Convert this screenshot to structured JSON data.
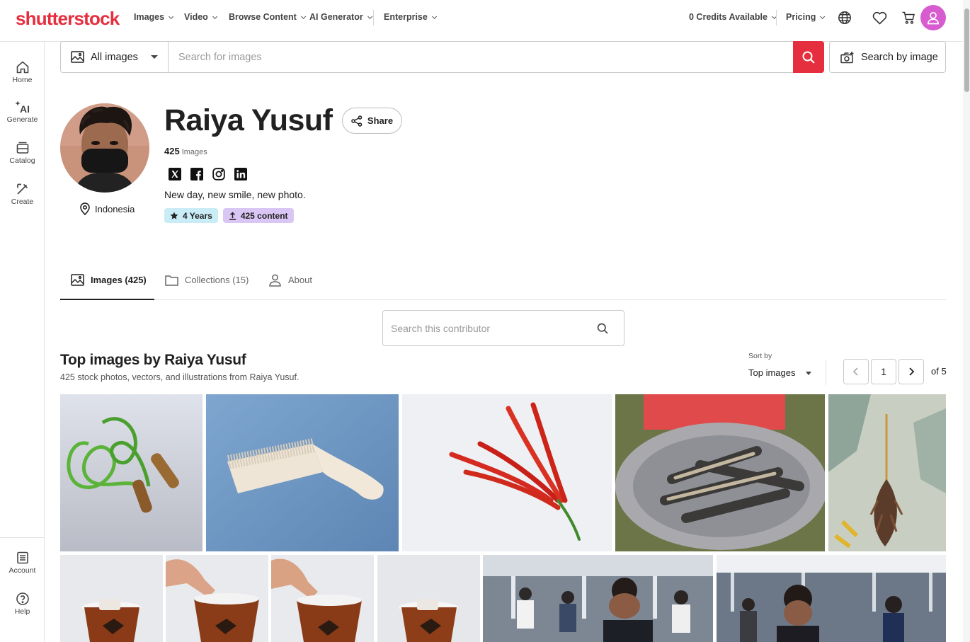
{
  "brand": {
    "logo_text": "shutterstock",
    "color": "#e62f3e"
  },
  "topnav": {
    "items": [
      {
        "label": "Images"
      },
      {
        "label": "Video"
      },
      {
        "label": "Browse Content"
      },
      {
        "label": "AI Generator"
      },
      {
        "label": "Enterprise"
      }
    ],
    "credits": "0 Credits Available",
    "pricing": "Pricing",
    "icons": [
      "globe-icon",
      "heart-icon",
      "cart-icon",
      "user-icon"
    ]
  },
  "rail": {
    "items": [
      {
        "label": "Home",
        "icon": "home-icon"
      },
      {
        "label": "Generate",
        "icon": "ai-sparkle-icon"
      },
      {
        "label": "Catalog",
        "icon": "catalog-icon"
      },
      {
        "label": "Create",
        "icon": "create-icon"
      }
    ],
    "bottom": [
      {
        "label": "Account",
        "icon": "account-icon"
      },
      {
        "label": "Help",
        "icon": "help-icon"
      }
    ]
  },
  "search": {
    "category": "All images",
    "placeholder": "Search for images",
    "by_image_label": "Search by image"
  },
  "profile": {
    "name": "Raiya Yusuf",
    "share_label": "Share",
    "image_count": "425",
    "image_count_label": "Images",
    "socials": [
      "x-icon",
      "facebook-icon",
      "instagram-icon",
      "linkedin-icon"
    ],
    "bio": "New day, new smile, new photo.",
    "location": "Indonesia",
    "badges": [
      {
        "label": "4 Years",
        "color": "#c9ecf7"
      },
      {
        "label": "425 content",
        "color": "#d9c6f5"
      }
    ]
  },
  "tabs": [
    {
      "label": "Images (425)",
      "active": true
    },
    {
      "label": "Collections (15)",
      "active": false
    },
    {
      "label": "About",
      "active": false
    }
  ],
  "contributor_search": {
    "placeholder": "Search this contributor"
  },
  "section": {
    "title": "Top images by Raiya Yusuf",
    "subtitle": "425 stock photos, vectors, and illustrations from Raiya Yusuf.",
    "sort_label": "Sort by",
    "sort_value": "Top images"
  },
  "pagination": {
    "current": "1",
    "total_label": "of 5"
  },
  "images_row1": [
    {
      "subject": "jump rope"
    },
    {
      "subject": "comb"
    },
    {
      "subject": "red chilies"
    },
    {
      "subject": "grilled fish"
    },
    {
      "subject": "feather duster"
    }
  ],
  "images_row2": [
    {
      "subject": "iced tea"
    },
    {
      "subject": "iced tea hand"
    },
    {
      "subject": "iced tea hand"
    },
    {
      "subject": "iced tea"
    },
    {
      "subject": "crowd"
    },
    {
      "subject": "crowd"
    }
  ]
}
